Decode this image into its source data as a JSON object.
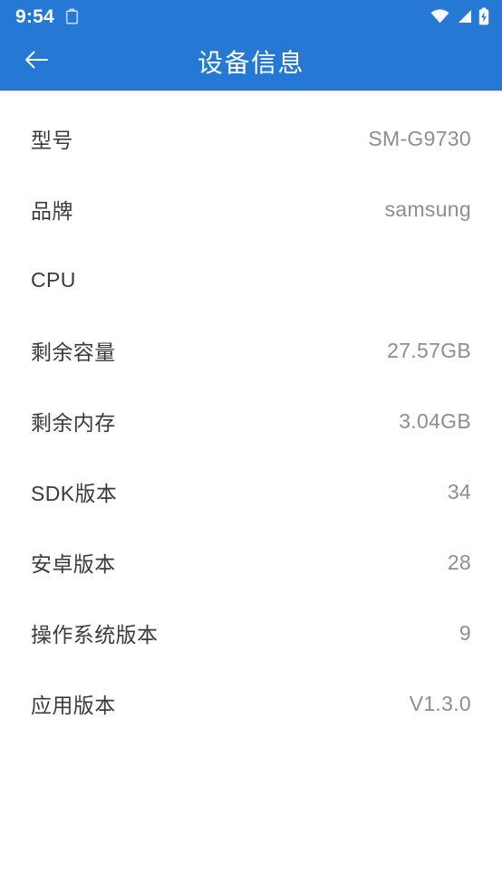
{
  "theme": {
    "accent": "#2579d4",
    "label_color": "#3b3b3b",
    "value_color": "#8e8e8e",
    "page_background": "#ffffff"
  },
  "status_bar": {
    "time": "9:54",
    "icons": {
      "clipboard": "clipboard-icon",
      "wifi": "wifi-icon",
      "signal": "cellular-signal-icon",
      "battery": "battery-charging-icon"
    }
  },
  "app_bar": {
    "back_icon": "arrow-left-icon",
    "title": "设备信息"
  },
  "info_rows": [
    {
      "label": "型号",
      "value": "SM-G9730"
    },
    {
      "label": "品牌",
      "value": "samsung"
    },
    {
      "label": "CPU",
      "value": ""
    },
    {
      "label": "剩余容量",
      "value": "27.57GB"
    },
    {
      "label": "剩余内存",
      "value": "3.04GB"
    },
    {
      "label": "SDK版本",
      "value": "34"
    },
    {
      "label": "安卓版本",
      "value": "28"
    },
    {
      "label": "操作系统版本",
      "value": "9"
    },
    {
      "label": "应用版本",
      "value": "V1.3.0"
    }
  ]
}
